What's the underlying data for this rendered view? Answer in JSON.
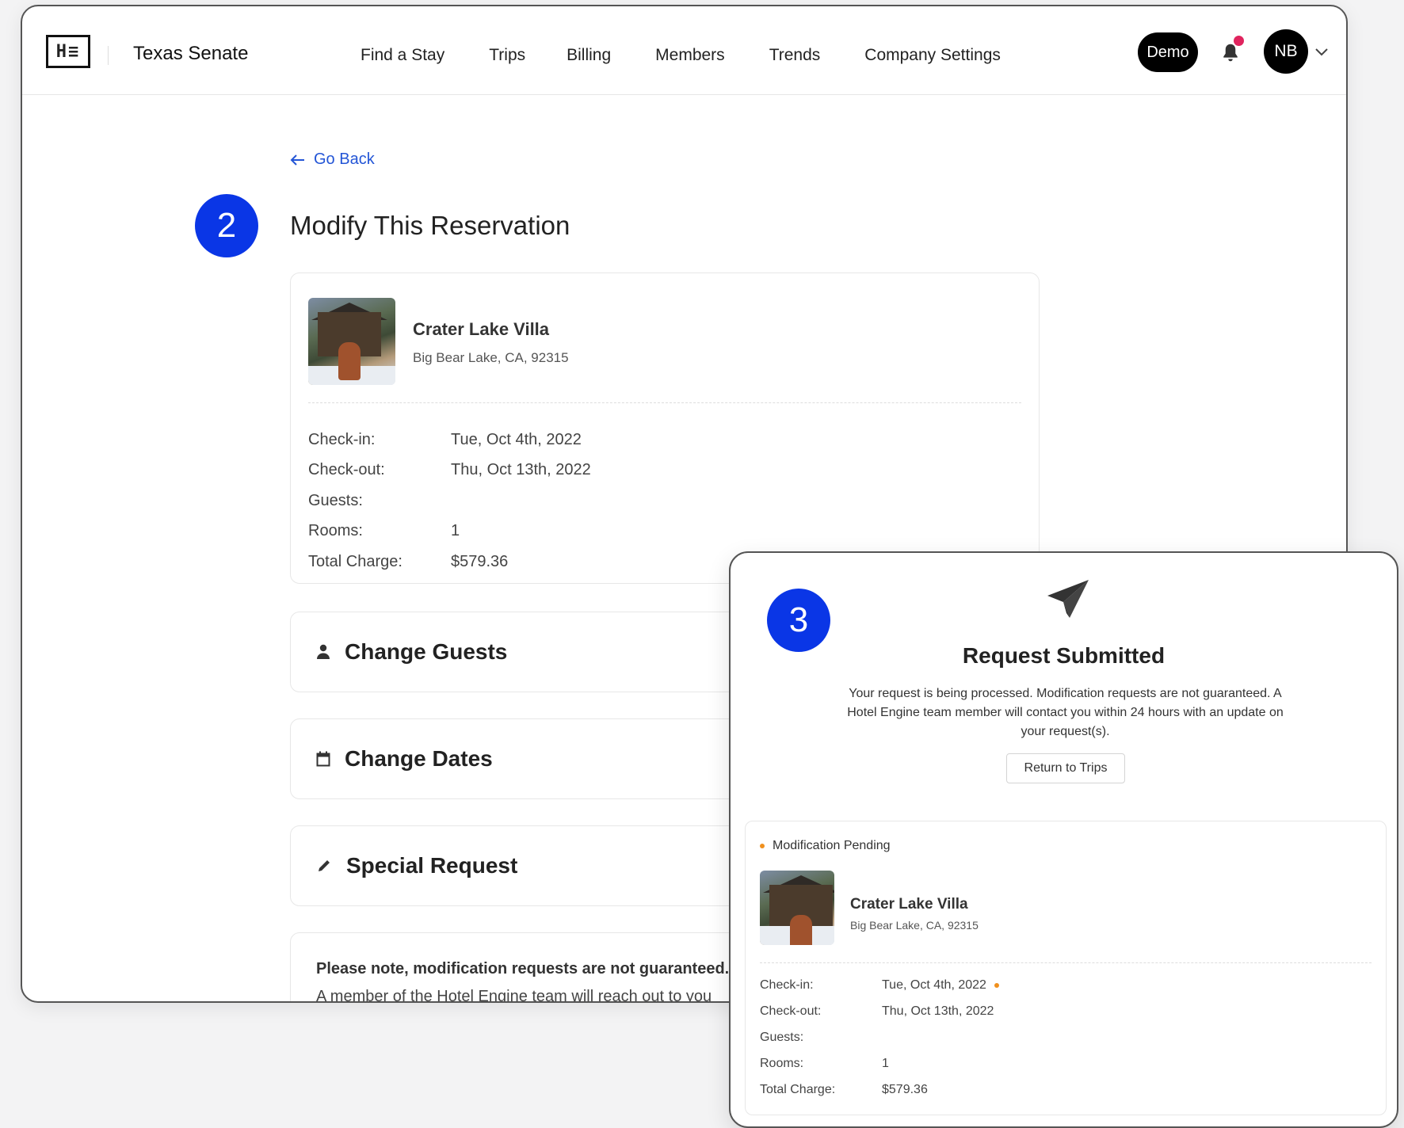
{
  "header": {
    "logo_text": "H≡",
    "company": "Texas Senate",
    "nav": [
      "Find a Stay",
      "Trips",
      "Billing",
      "Members",
      "Trends",
      "Company Settings"
    ],
    "demo_label": "Demo",
    "avatar_initials": "NB"
  },
  "main": {
    "go_back": "Go Back",
    "step": "2",
    "title": "Modify This Reservation",
    "reservation": {
      "hotel_name": "Crater Lake Villa",
      "address": "Big Bear Lake, CA, 92315",
      "rows": [
        {
          "label": "Check-in:",
          "value": "Tue, Oct 4th, 2022"
        },
        {
          "label": "Check-out:",
          "value": "Thu, Oct 13th, 2022"
        },
        {
          "label": "Guests:",
          "value": ""
        },
        {
          "label": "Rooms:",
          "value": "1"
        },
        {
          "label": "Total Charge:",
          "value": "$579.36"
        }
      ]
    },
    "actions": {
      "change_guests": "Change Guests",
      "change_dates": "Change Dates",
      "special_request": "Special Request"
    },
    "note": {
      "strong": "Please note, modification requests are not guaranteed.",
      "sub": "A member of the Hotel Engine team will reach out to you"
    }
  },
  "overlay": {
    "step": "3",
    "title": "Request Submitted",
    "body": "Your request is being processed. Modification requests are not guaranteed. A Hotel Engine team member will contact you within 24 hours with an update on your request(s).",
    "return_button": "Return to Trips",
    "pending": {
      "status": "Modification Pending",
      "hotel_name": "Crater Lake Villa",
      "address": "Big Bear Lake, CA, 92315",
      "rows": [
        {
          "label": "Check-in:",
          "value": "Tue, Oct 4th, 2022"
        },
        {
          "label": "Check-out:",
          "value": "Thu, Oct 13th, 2022"
        },
        {
          "label": "Guests:",
          "value": ""
        },
        {
          "label": "Rooms:",
          "value": "1"
        },
        {
          "label": "Total Charge:",
          "value": "$579.36"
        }
      ]
    }
  },
  "colors": {
    "accent": "#0a36e6",
    "link": "#2355d6",
    "notification": "#e0245e",
    "pending": "#f0901e"
  },
  "icons": {
    "go_back": "arrow-left-icon",
    "guests": "person-icon",
    "dates": "calendar-icon",
    "special": "pencil-icon",
    "submitted": "paper-plane-icon",
    "notifications": "bell-icon",
    "menu": "chevron-down-icon"
  }
}
